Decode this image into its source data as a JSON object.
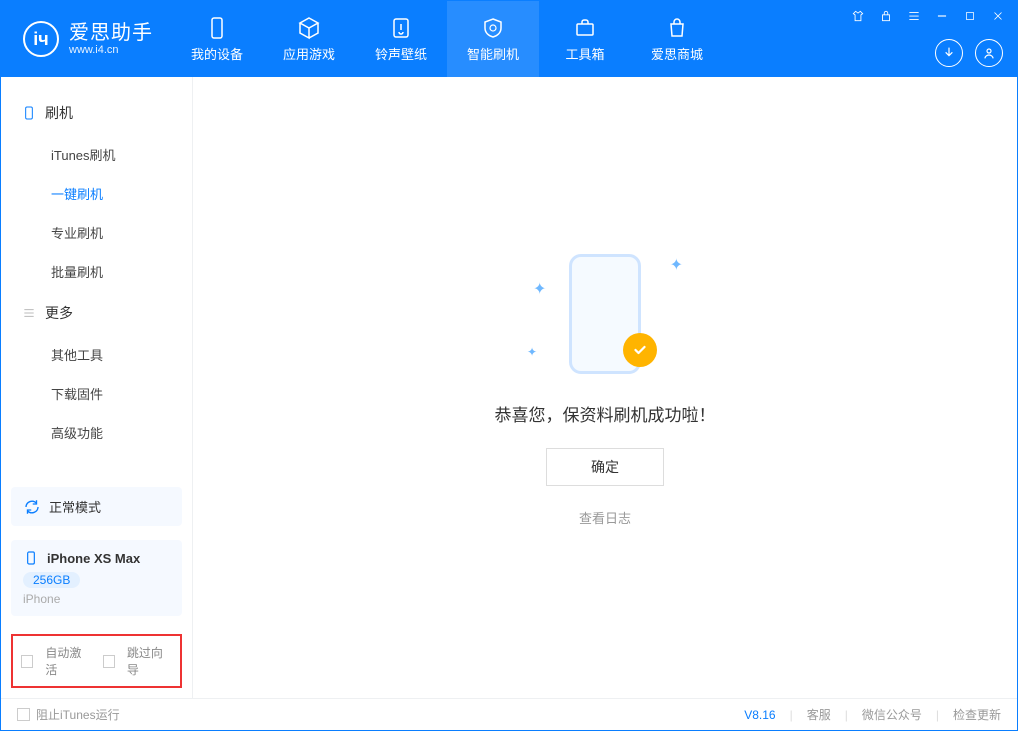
{
  "app": {
    "name": "爱思助手",
    "url": "www.i4.cn"
  },
  "nav": {
    "items": [
      {
        "label": "我的设备"
      },
      {
        "label": "应用游戏"
      },
      {
        "label": "铃声壁纸"
      },
      {
        "label": "智能刷机"
      },
      {
        "label": "工具箱"
      },
      {
        "label": "爱思商城"
      }
    ]
  },
  "sidebar": {
    "section1": {
      "title": "刷机",
      "items": [
        "iTunes刷机",
        "一键刷机",
        "专业刷机",
        "批量刷机"
      ]
    },
    "section2": {
      "title": "更多",
      "items": [
        "其他工具",
        "下载固件",
        "高级功能"
      ]
    },
    "mode": "正常模式",
    "device": {
      "name": "iPhone XS Max",
      "storage": "256GB",
      "type": "iPhone"
    },
    "opts": {
      "auto_activate": "自动激活",
      "skip_guide": "跳过向导"
    }
  },
  "main": {
    "message": "恭喜您，保资料刷机成功啦！",
    "ok": "确定",
    "view_log": "查看日志"
  },
  "footer": {
    "block_itunes": "阻止iTunes运行",
    "version": "V8.16",
    "links": [
      "客服",
      "微信公众号",
      "检查更新"
    ]
  }
}
